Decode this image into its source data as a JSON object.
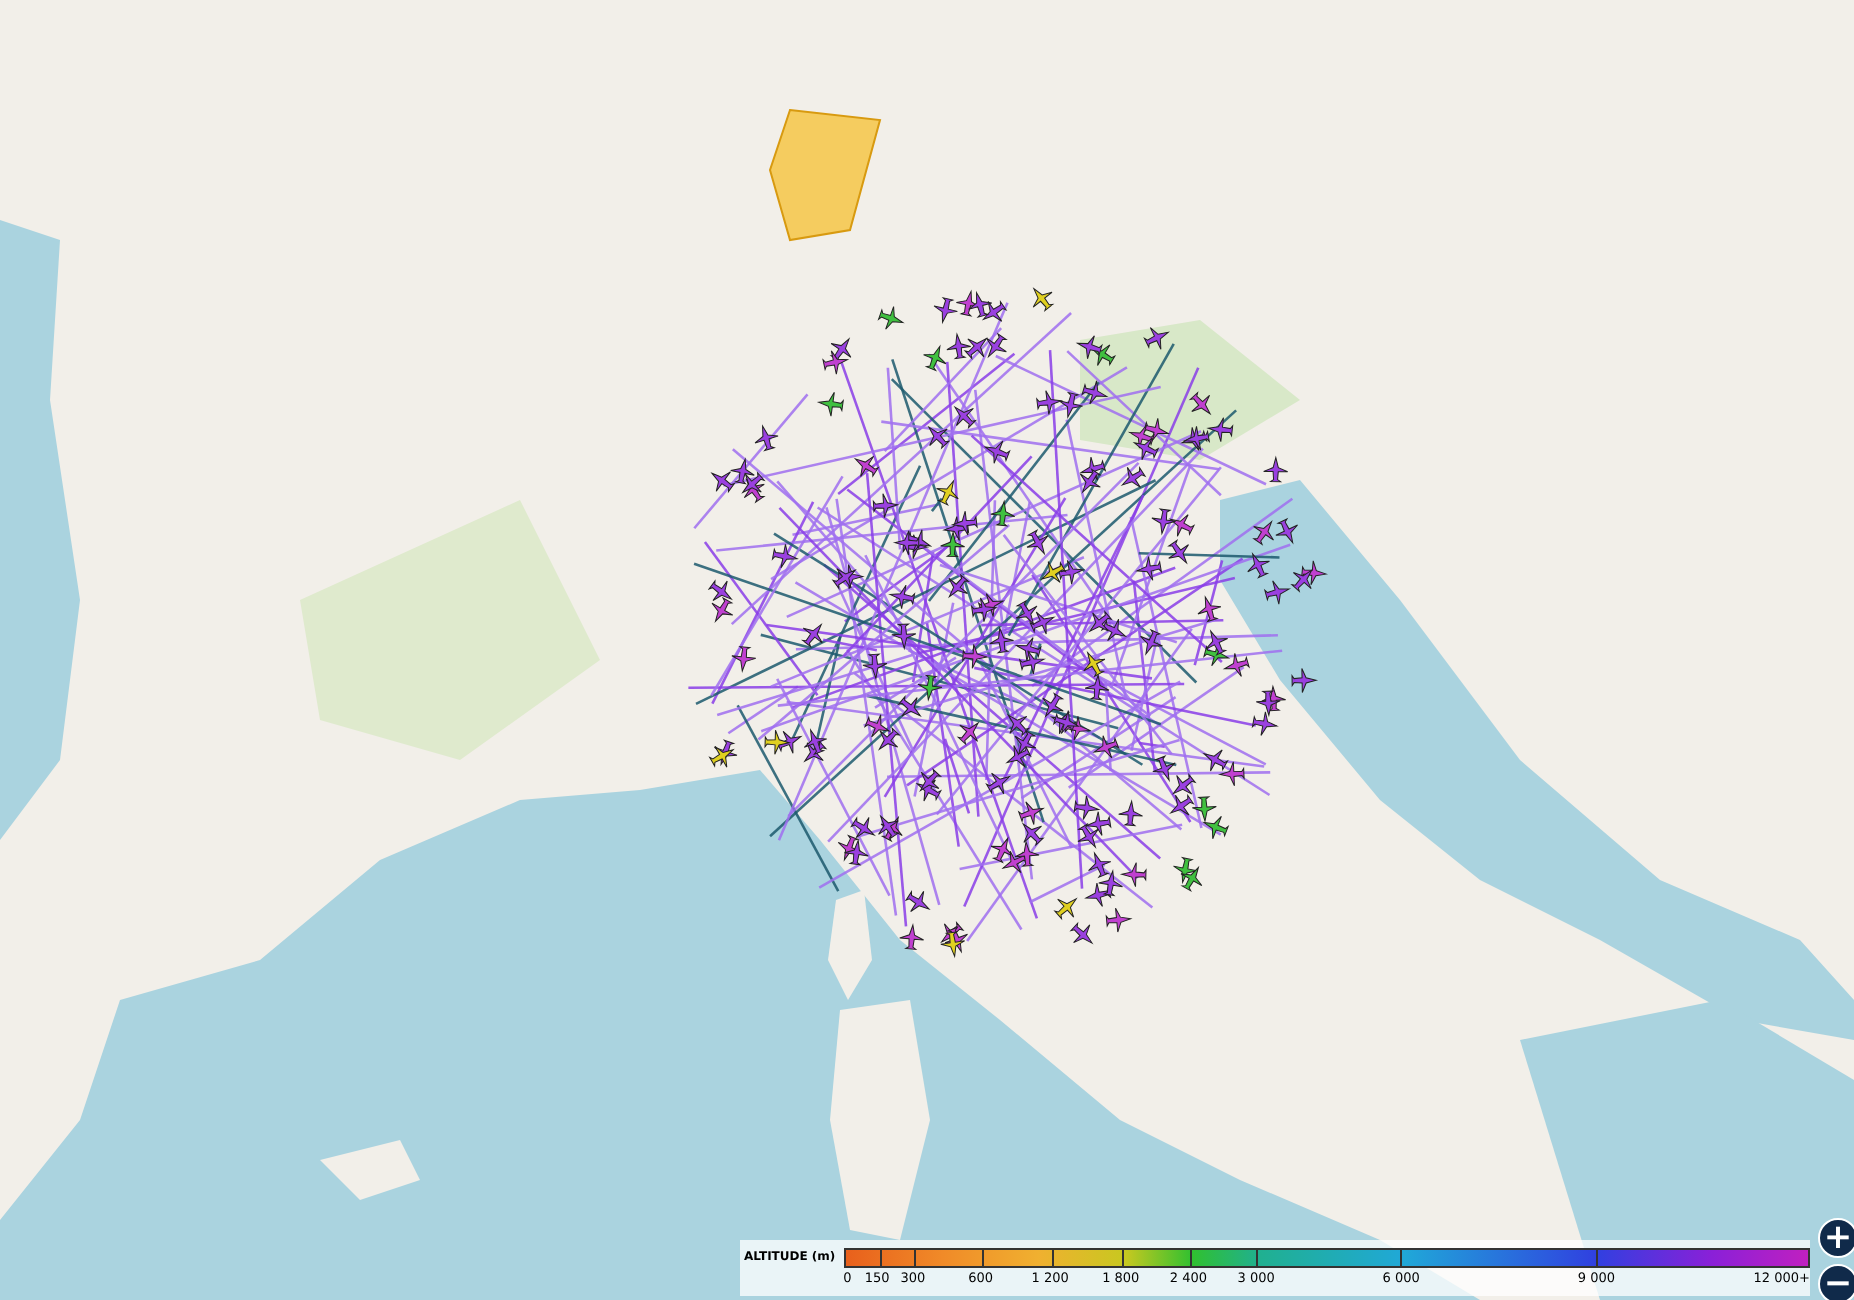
{
  "legend": {
    "title": "ALTITUDE (m)",
    "ticks": [
      "0",
      "150",
      "300",
      "600",
      "1 200",
      "1 800",
      "2 400",
      "3 000",
      "6 000",
      "9 000",
      "12 000+"
    ]
  },
  "zoom_controls": [
    {
      "label": "+"
    },
    {
      "label": "−"
    }
  ]
}
